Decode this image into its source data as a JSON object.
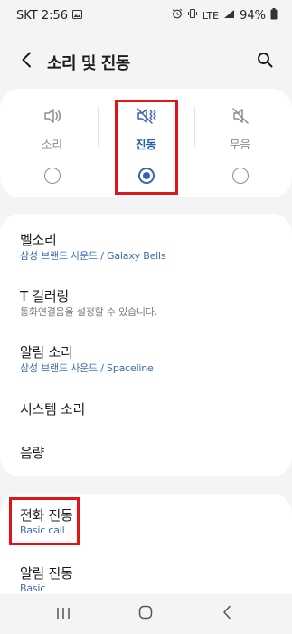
{
  "status_bar": {
    "carrier_time": "SKT 2:56",
    "network": "LTE",
    "battery": "94%"
  },
  "header": {
    "title": "소리 및 진동"
  },
  "sound_modes": {
    "selected": "진동",
    "items": [
      {
        "label": "소리",
        "icon": "speaker-icon"
      },
      {
        "label": "진동",
        "icon": "vibrate-icon"
      },
      {
        "label": "무음",
        "icon": "mute-icon"
      }
    ]
  },
  "settings": {
    "items": [
      {
        "title": "벨소리",
        "subtitle": "삼성 브랜드 사운드 / Galaxy Bells"
      },
      {
        "title": "T 컬러링",
        "subtitle": "통화연결음을 설정할 수 있습니다."
      },
      {
        "title": "알림 소리",
        "subtitle": "삼성 브랜드 사운드 / Spaceline"
      },
      {
        "title": "시스템 소리"
      },
      {
        "title": "음량"
      }
    ]
  },
  "vibration": {
    "items": [
      {
        "title": "전화 진동",
        "subtitle": "Basic call"
      },
      {
        "title": "알림 진동",
        "subtitle": "Basic"
      }
    ]
  },
  "colors": {
    "accent": "#3b63b5",
    "highlight": "#e0141b"
  }
}
